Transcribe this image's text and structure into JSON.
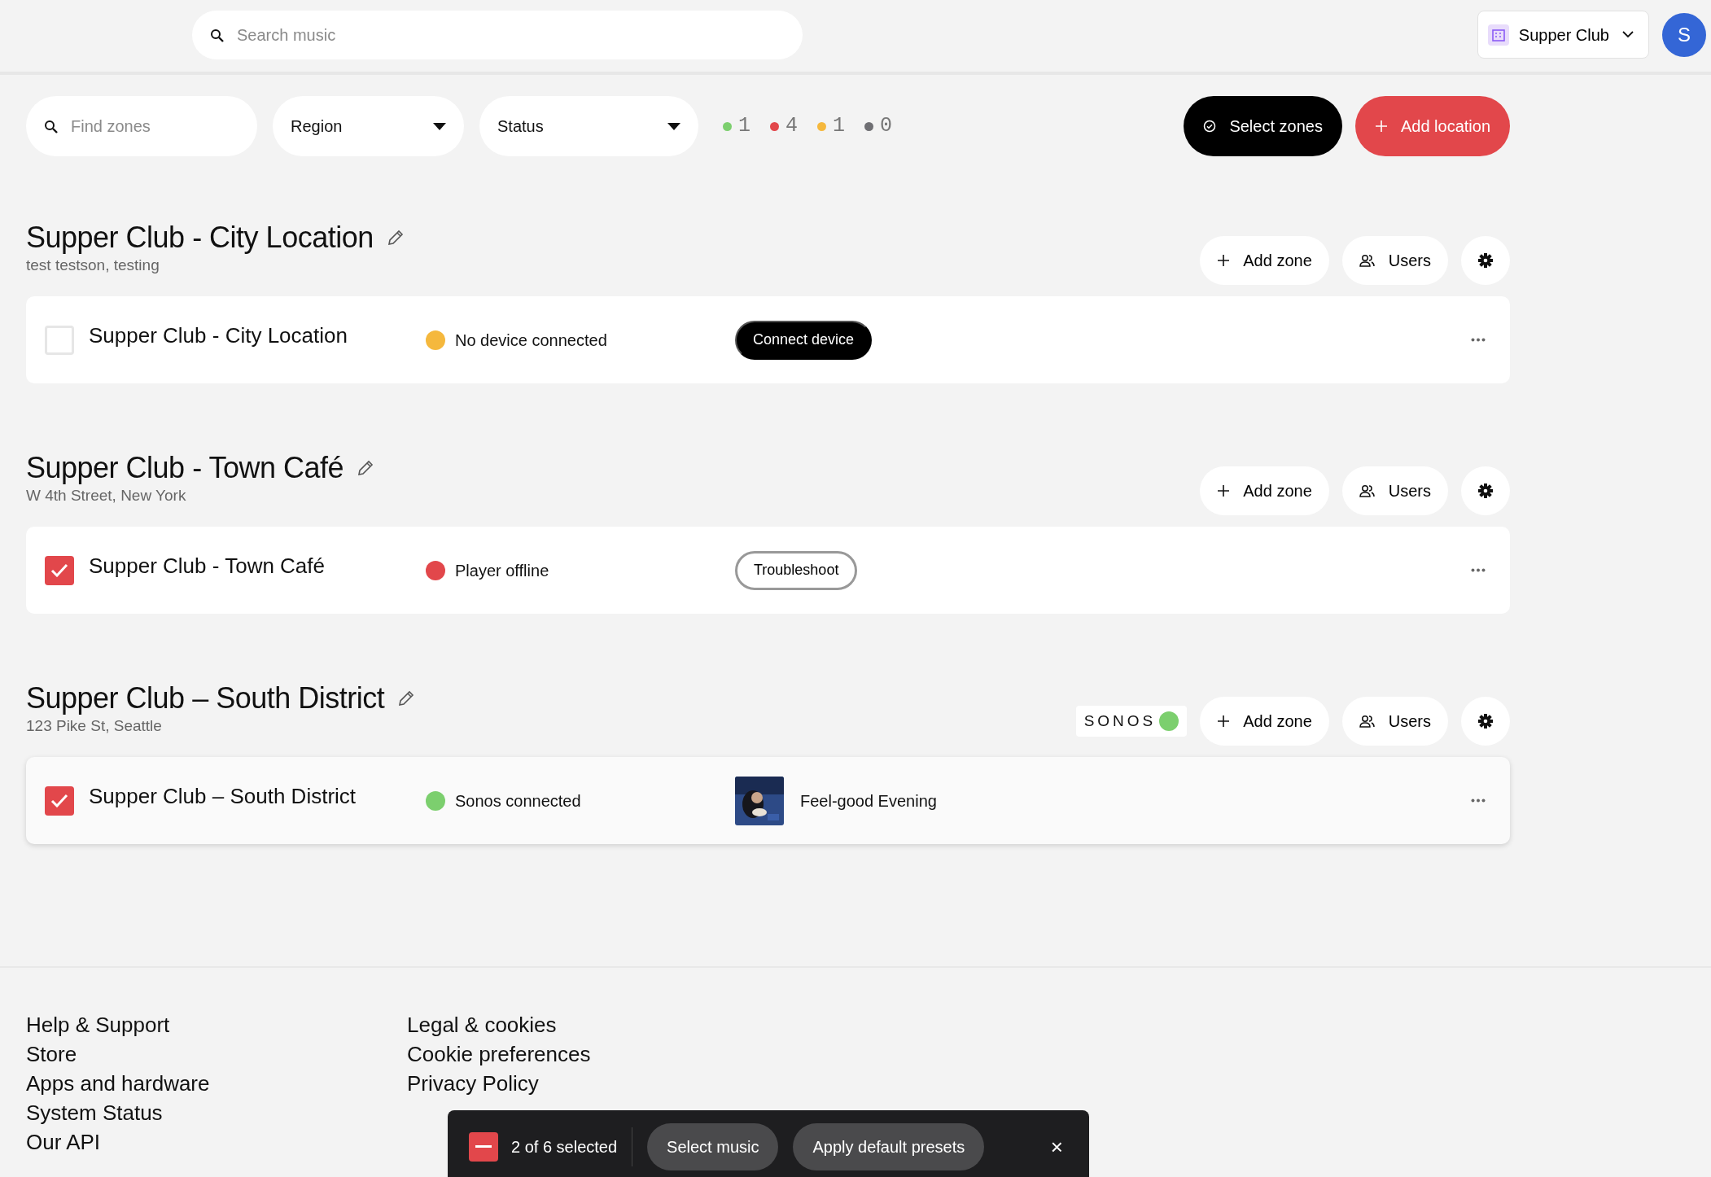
{
  "header": {
    "search": {
      "placeholder": "Search music"
    },
    "account": {
      "name": "Supper Club"
    },
    "avatar": {
      "initial": "S"
    }
  },
  "filters": {
    "find": {
      "placeholder": "Find zones"
    },
    "dropdowns": [
      "Region",
      "Status"
    ],
    "counts": [
      {
        "value": "1",
        "color": "#7ccf6e"
      },
      {
        "value": "4",
        "color": "#e2474b"
      },
      {
        "value": "1",
        "color": "#f5b83d"
      },
      {
        "value": "0",
        "color": "#6f6f73"
      }
    ],
    "buttons": [
      {
        "label": "Select zones",
        "kind": "dark"
      },
      {
        "label": "Add location",
        "kind": "primary"
      }
    ]
  },
  "locations": [
    {
      "title": "Supper Club - City Location",
      "address": "test testson, testing",
      "add_zone": "Add zone",
      "users": "Users",
      "zones": [
        {
          "name": "Supper Club - City Location",
          "checked": false,
          "highlighted": false,
          "status": "No device connected",
          "color": "#f5b83d",
          "action": {
            "label": "Connect device",
            "kind": "dark"
          }
        }
      ]
    },
    {
      "title": "Supper Club - Town Café",
      "address": "W 4th Street, New York",
      "add_zone": "Add zone",
      "users": "Users",
      "zones": [
        {
          "name": "Supper Club - Town Café",
          "checked": true,
          "highlighted": false,
          "status": "Player offline",
          "color": "#e2474b",
          "action": {
            "label": "Troubleshoot",
            "kind": "outline"
          }
        }
      ]
    },
    {
      "title": "Supper Club – South District",
      "address": "123 Pike St, Seattle",
      "add_zone": "Add zone",
      "users": "Users",
      "sonos": {
        "label": "SONOS",
        "color": "#7ccf6e"
      },
      "zones": [
        {
          "name": "Supper Club – South District",
          "checked": true,
          "highlighted": true,
          "status": "Sonos connected",
          "color": "#7ccf6e",
          "playlist": {
            "title": "Feel-good Evening",
            "kind": "picture"
          }
        }
      ]
    }
  ],
  "footer": {
    "columns": [
      [
        "Help & Support",
        "Store",
        "Apps and hardware",
        "System Status",
        "Our API"
      ],
      [
        "Legal & cookies",
        "Cookie preferences",
        "Privacy Policy"
      ]
    ]
  },
  "selection_bar": {
    "indeterminate": true,
    "count": "2 of 6 selected",
    "buttons": [
      "Select music",
      "Apply default presets"
    ],
    "close": "×"
  }
}
